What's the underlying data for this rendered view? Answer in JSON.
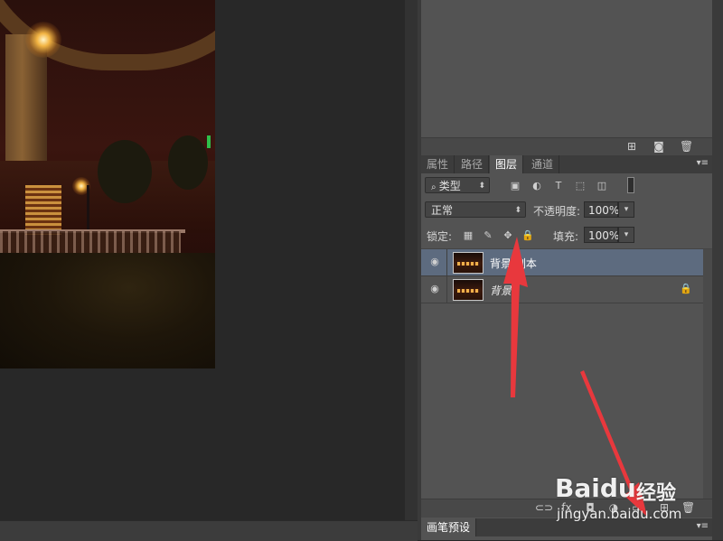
{
  "canvas": {
    "photo_description_icon": "night-bridge-photo"
  },
  "history_panel": {
    "footer_icons": [
      "new-snapshot-icon",
      "camera-icon",
      "trash-icon"
    ]
  },
  "panel_tabs": {
    "tabs": [
      {
        "label": "属性",
        "active": false
      },
      {
        "label": "路径",
        "active": false
      },
      {
        "label": "图层",
        "active": true
      },
      {
        "label": "通道",
        "active": false
      }
    ],
    "menu_glyph": "▾≡"
  },
  "filter_row": {
    "kind_label": "类型",
    "filter_icons": [
      "image-filter-icon",
      "adjustment-filter-icon",
      "type-filter-icon",
      "shape-filter-icon",
      "smart-object-filter-icon",
      "filter-toggle-icon"
    ]
  },
  "blend_row": {
    "blend_mode": "正常",
    "opacity_label": "不透明度:",
    "opacity_value": "100%"
  },
  "lock_row": {
    "lock_label": "锁定:",
    "fill_label": "填充:",
    "fill_value": "100%"
  },
  "layers": [
    {
      "name": "背景 副本",
      "selected": true,
      "locked": false,
      "italic": false
    },
    {
      "name": "背景",
      "selected": false,
      "locked": true,
      "italic": true
    }
  ],
  "brush_presets_tab": "画笔预设",
  "watermark": {
    "brand": "Baidu",
    "brand_cn": "经验",
    "url": "jingyan.baidu.com"
  },
  "colors": {
    "panel_bg": "#535353",
    "selected_layer": "#5d6b7f",
    "annotation_arrow": "#e8383d"
  }
}
